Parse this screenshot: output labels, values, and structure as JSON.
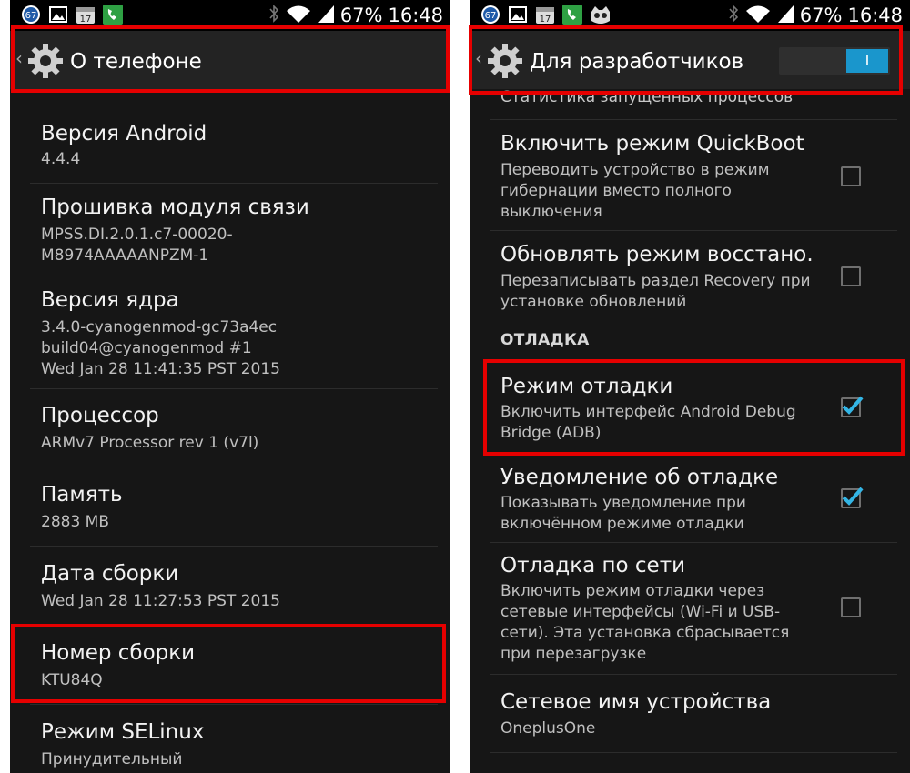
{
  "left_screen": {
    "status_bar": {
      "badge": "67",
      "calendar_day": "17",
      "battery": "67%",
      "time": "16:48"
    },
    "action_bar": {
      "title": "О телефоне"
    },
    "items": [
      {
        "title": "Версия Android",
        "summary": [
          "4.4.4"
        ]
      },
      {
        "title": "Прошивка модуля связи",
        "summary": [
          "MPSS.DI.2.0.1.c7-00020-",
          "M8974AAAAANPZM-1"
        ]
      },
      {
        "title": "Версия ядра",
        "summary": [
          "3.4.0-cyanogenmod-gc73a4ec",
          "build04@cyanogenmod #1",
          "Wed Jan 28 11:41:35 PST 2015"
        ]
      },
      {
        "title": "Процессор",
        "summary": [
          "ARMv7 Processor rev 1 (v7l)"
        ]
      },
      {
        "title": "Память",
        "summary": [
          "2883 MB"
        ]
      },
      {
        "title": "Дата сборки",
        "summary": [
          "Wed Jan 28 11:27:53 PST 2015"
        ]
      },
      {
        "title": "Номер сборки",
        "summary": [
          "KTU84Q"
        ]
      },
      {
        "title": "Режим SELinux",
        "summary": [
          "Принудительный"
        ]
      }
    ]
  },
  "right_screen": {
    "status_bar": {
      "badge": "67",
      "calendar_day": "17",
      "battery": "67%",
      "time": "16:48"
    },
    "action_bar": {
      "title": "Для разработчиков",
      "switch_label": "I"
    },
    "top_partial": "Статистика запущенных процессов",
    "items": [
      {
        "title": "Включить режим QuickBoot",
        "summary": [
          "Переводить устройство в режим",
          "гибернации вместо полного",
          "выключения"
        ],
        "checked": false
      },
      {
        "title": "Обновлять режим восстано.",
        "summary": [
          "Перезаписывать раздел Recovery при",
          "установке обновлений"
        ],
        "checked": false
      },
      {
        "title": "Режим отладки",
        "summary": [
          "Включить интерфейс Android Debug",
          "Bridge (ADB)"
        ],
        "checked": true
      },
      {
        "title": "Уведомление об отладке",
        "summary": [
          "Показывать уведомление при",
          "включённом режиме отладки"
        ],
        "checked": true
      },
      {
        "title": "Отладка по сети",
        "summary": [
          "Включить режим отладки через",
          "сетевые интерфейсы (Wi-Fi и USB-",
          "сети). Эта установка сбрасывается",
          "при перезагрузке"
        ],
        "checked": false
      },
      {
        "title": "Сетевое имя устройства",
        "summary": [
          "OneplusOne"
        ]
      }
    ],
    "section_header": "ОТЛАДКА"
  },
  "colors": {
    "highlight": "#e60000",
    "accent": "#1a96cc",
    "background": "#161616"
  }
}
